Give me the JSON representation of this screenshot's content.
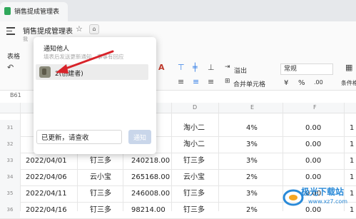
{
  "tab": {
    "doc_title": "销售提成管理表"
  },
  "header": {
    "doc_title": "销售提成管理表",
    "doc_subtitle": "我"
  },
  "toolbar": {
    "left_label": "表格",
    "font_color_icon": "A",
    "merge_label": "合并单元格",
    "overflow_label": "溢出",
    "format_value": "常规",
    "currency_symbol": "¥",
    "percent_symbol": "%",
    "decimal_label": ".00",
    "condition_label": "条件格"
  },
  "formula": {
    "cell_ref": "B61"
  },
  "columns": [
    "D",
    "E",
    "F"
  ],
  "rows": [
    {
      "num": "31",
      "date": "",
      "name": "",
      "amount": "",
      "d": "淘小二",
      "rate": "4%",
      "f": "0.00",
      "g": "1"
    },
    {
      "num": "32",
      "date": "",
      "name": "",
      "amount": "",
      "d": "淘小二",
      "rate": "3%",
      "f": "0.00",
      "g": "1"
    },
    {
      "num": "33",
      "date": "2022/04/01",
      "name": "钉三多",
      "amount": "240218.00",
      "d": "钉三多",
      "rate": "3%",
      "f": "0.00",
      "g": "1"
    },
    {
      "num": "34",
      "date": "2022/04/06",
      "name": "云小宝",
      "amount": "265168.00",
      "d": "云小宝",
      "rate": "2%",
      "f": "0.00",
      "g": "1"
    },
    {
      "num": "35",
      "date": "2022/04/11",
      "name": "钉三多",
      "amount": "246008.00",
      "d": "钉三多",
      "rate": "3%",
      "f": "0.00",
      "g": "1"
    },
    {
      "num": "36",
      "date": "2022/04/16",
      "name": "钉三多",
      "amount": "98214.00",
      "d": "钉三多",
      "rate": "2%",
      "f": "0.00",
      "g": "1"
    }
  ],
  "notify_popup": {
    "title": "通知他人",
    "hint": "填表后发送更新通知，事事有回应",
    "user": "2(创建者)",
    "message": "已更新，请查收",
    "button": "通知"
  },
  "watermark": {
    "text": "极光下载站",
    "url": "www.xz7.com"
  }
}
